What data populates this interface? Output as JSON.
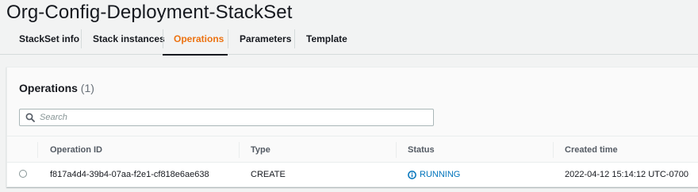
{
  "page": {
    "title": "Org-Config-Deployment-StackSet"
  },
  "tabs": [
    {
      "label": "StackSet info"
    },
    {
      "label": "Stack instances"
    },
    {
      "label": "Operations"
    },
    {
      "label": "Parameters"
    },
    {
      "label": "Template"
    }
  ],
  "active_tab": "Operations",
  "operations_panel": {
    "title": "Operations",
    "count": "(1)",
    "search": {
      "placeholder": "Search",
      "value": ""
    },
    "columns": [
      "Operation ID",
      "Type",
      "Status",
      "Created time"
    ],
    "rows": [
      {
        "operation_id": "f817a4d4-39b4-07aa-f2e1-cf818e6ae638",
        "type": "CREATE",
        "status": "RUNNING",
        "created_time": "2022-04-12 15:14:12 UTC-0700"
      }
    ]
  },
  "colors": {
    "active_tab": "#ec7211",
    "link_blue": "#0073bb",
    "background": "#f2f3f3"
  },
  "icons": {
    "search": "search-icon",
    "status_running": "info-circle-icon"
  }
}
